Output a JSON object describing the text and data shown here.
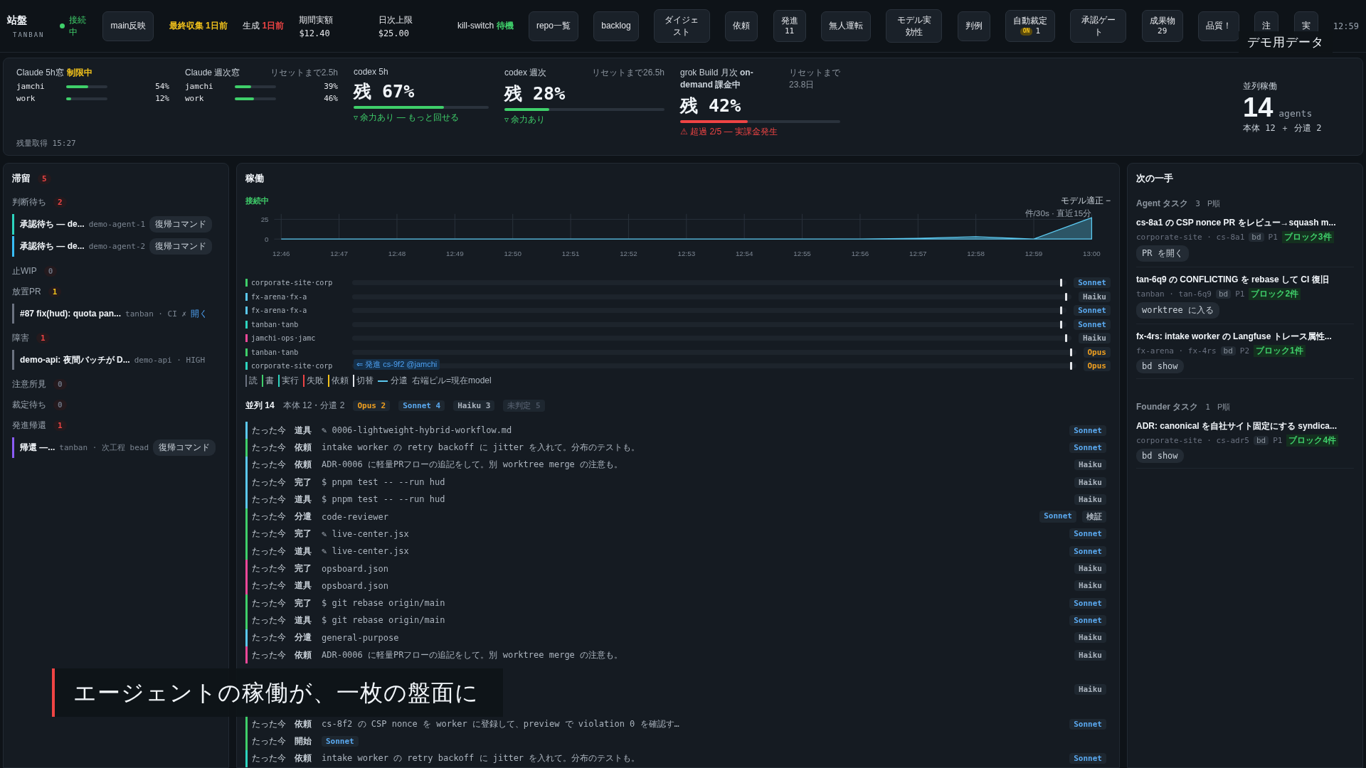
{
  "top_bar": {
    "brand": {
      "title": "站盤",
      "subtitle": "TANBAN"
    },
    "connection": {
      "label": "接続中",
      "on": true
    },
    "items": [
      {
        "kind": "button",
        "label": "main反映"
      },
      {
        "kind": "alert",
        "label": "最終収集 1日前",
        "color": "#f2c21b"
      },
      {
        "kind": "flag",
        "label": "生成",
        "value": "1日前",
        "color": "#ef4444"
      },
      {
        "kind": "stat",
        "label": "期間実額",
        "value": "$12.40"
      },
      {
        "kind": "stat",
        "label": "日次上限",
        "value": "$25.00"
      },
      {
        "kind": "flag",
        "label": "kill-switch",
        "value": "待機",
        "color": "#3fcf6a"
      },
      {
        "kind": "button",
        "label": "repo一覧"
      },
      {
        "kind": "button",
        "label": "backlog"
      },
      {
        "kind": "button",
        "label": "ダイジェスト"
      },
      {
        "kind": "button",
        "label": "依頼"
      },
      {
        "kind": "button",
        "label": "発進",
        "sub": "11"
      },
      {
        "kind": "button",
        "label": "無人運転"
      },
      {
        "kind": "button",
        "label": "モデル実効性"
      },
      {
        "kind": "button",
        "label": "判例"
      },
      {
        "kind": "button",
        "label": "自動裁定",
        "badge": "ON",
        "sub": "1"
      },
      {
        "kind": "button",
        "label": "承認ゲート"
      },
      {
        "kind": "button",
        "label": "成果物",
        "sub": "29"
      },
      {
        "kind": "button",
        "label": "品質！"
      },
      {
        "kind": "button",
        "label": "注"
      },
      {
        "kind": "button",
        "label": "実"
      }
    ],
    "clock": "12:59"
  },
  "demo_badge": "デモ用データ",
  "quota": {
    "groups": [
      {
        "kind": "accounts",
        "header": "Claude 5h窓",
        "flag": "制限中",
        "accounts": [
          {
            "name": "jamchi",
            "level": 0.54,
            "reading": "54%"
          },
          {
            "name": "work",
            "level": 0.12,
            "reading": "12%"
          }
        ]
      },
      {
        "kind": "accounts",
        "header": "Claude 週次窓",
        "reset": "リセットまで2.5h",
        "accounts": [
          {
            "name": "jamchi",
            "level": 0.39,
            "reading": "39%"
          },
          {
            "name": "work",
            "level": 0.46,
            "reading": "46%"
          }
        ]
      },
      {
        "kind": "remaining",
        "header": "codex 5h",
        "value": "残 67%",
        "level": 0.67,
        "color": "#3fcf6a",
        "note": "▿ 余力あり — もっと回せる"
      },
      {
        "kind": "remaining",
        "header": "codex 週次",
        "reset": "リセットまで26.5h",
        "value": "残 28%",
        "level": 0.28,
        "color": "#3fcf6a",
        "note": "▿ 余力あり"
      },
      {
        "kind": "remaining",
        "header": "grok Build 月次 **on-demand 課金中**",
        "reset": "リセットまで23.8日",
        "value": "残 42%",
        "level": 0.42,
        "color": "#ef4444",
        "note": "⚠ 超過 2/5 — 実課金発生"
      }
    ],
    "footer": "残量取得 15:27",
    "parallel": {
      "label": "並列稼働",
      "value": "14",
      "unit": "agents",
      "detail": "本体 12 ＋ 分遣 2"
    }
  },
  "backlog": {
    "title": "滞留",
    "count": "5",
    "color": "#ef4444",
    "groups": [
      {
        "label": "判断待ち",
        "count": "2",
        "color": "#ef4444",
        "items": [
          {
            "title": "承認待ち — de...",
            "meta": "demo-agent-1",
            "color": "#2dd4bf",
            "action": {
              "kind": "button",
              "label": "復帰コマンド"
            }
          },
          {
            "title": "承認待ち — de...",
            "meta": "demo-agent-2",
            "color": "#38bdf8",
            "action": {
              "kind": "button",
              "label": "復帰コマンド"
            }
          }
        ]
      },
      {
        "label": "止WIP",
        "count": "0",
        "color": "#6b7280"
      },
      {
        "label": "放置PR",
        "count": "1",
        "color": "#f2c21b",
        "items": [
          {
            "title": "#87 fix(hud): quota pan...",
            "meta": "tanban · CI ✗",
            "color": "#6b7280",
            "action": {
              "kind": "link",
              "label": "開く"
            }
          }
        ]
      },
      {
        "label": "障害",
        "count": "1",
        "color": "#ef4444",
        "items": [
          {
            "title": "demo-api: 夜間バッチが D...",
            "meta": "demo-api · HIGH",
            "color": "#6b7280"
          }
        ]
      },
      {
        "label": "注意所見",
        "count": "0",
        "color": "#6b7280"
      },
      {
        "label": "裁定待ち",
        "count": "0",
        "color": "#6b7280"
      },
      {
        "label": "発進帰還",
        "count": "1",
        "color": "#ef4444",
        "items": [
          {
            "title": "帰還 —...",
            "meta": "tanban · 次工程 bead",
            "color": "#8b5cf6",
            "action": {
              "kind": "button",
              "label": "復帰コマンド"
            }
          }
        ]
      }
    ]
  },
  "activity": {
    "title": "稼働",
    "status": "接続中",
    "toggle": "モデル適正 −",
    "chart_data": {
      "type": "area",
      "grid": true,
      "ylabel": "件/30s · 直近15分",
      "x": [
        "12:46",
        "12:47",
        "12:48",
        "12:49",
        "12:50",
        "12:51",
        "12:52",
        "12:53",
        "12:54",
        "12:55",
        "12:56",
        "12:57",
        "12:58",
        "12:59",
        "13:00"
      ],
      "yticks": [
        0,
        25
      ],
      "ylim": [
        0,
        30
      ],
      "series": [
        {
          "color": "#5bc8ef",
          "values": [
            0,
            0,
            0,
            0,
            0,
            0,
            0,
            0,
            0,
            0,
            0,
            1,
            3,
            0,
            27
          ]
        }
      ]
    },
    "lanes": [
      {
        "name": "corporate-site·corp",
        "color": "#3fcf6a",
        "model": {
          "label": "Sonnet",
          "color": "#5aa9f0"
        }
      },
      {
        "name": "fx-arena·fx-a",
        "color": "#5bc8ef",
        "model": {
          "label": "Haiku",
          "color": "#aab3bd"
        }
      },
      {
        "name": "fx-arena·fx-a",
        "color": "#5bc8ef",
        "model": {
          "label": "Sonnet",
          "color": "#5aa9f0"
        }
      },
      {
        "name": "tanban·tanb",
        "color": "#2dd4bf",
        "model": {
          "label": "Sonnet",
          "color": "#5aa9f0"
        }
      },
      {
        "name": "jamchi-ops·jamc",
        "color": "#ec4899",
        "model": {
          "label": "Haiku",
          "color": "#aab3bd"
        }
      },
      {
        "name": "tanban·tanb",
        "color": "#3fcf6a",
        "model": {
          "label": "Opus",
          "color": "#f0a020"
        }
      },
      {
        "name": "corporate-site·corp",
        "color": "#2dd4bf",
        "link": "⇐ 発進 cs-9f2 @jamchi",
        "model": {
          "label": "Opus",
          "color": "#f0a020"
        }
      }
    ],
    "legend": [
      {
        "label": "読",
        "color": "#6b7280"
      },
      {
        "label": "書",
        "color": "#3fcf6a"
      },
      {
        "label": "実行",
        "color": "#2dd4bf"
      },
      {
        "label": "失敗",
        "color": "#ef4444"
      },
      {
        "label": "依頼",
        "color": "#f2c21b"
      },
      {
        "label": "切替",
        "color": "#e5e7eb"
      }
    ],
    "legend_branch": "分遣",
    "legend_note": "右端ピル=現在model",
    "summary": {
      "label": "並列 14",
      "detail": "本体 12・分遣 2",
      "pills": [
        {
          "label": "Opus 2",
          "color": "#f0a020"
        },
        {
          "label": "Sonnet 4",
          "color": "#5aa9f0"
        },
        {
          "label": "Haiku 3",
          "color": "#aab3bd"
        },
        {
          "label": "未判定 5",
          "color": "#4b5563"
        }
      ]
    },
    "rows": [
      {
        "kind": "event",
        "time": "たった今",
        "type": "道具",
        "text": "✎ 0006-lightweight-hybrid-workflow.md",
        "color": "#5bc8ef",
        "models": [
          {
            "label": "Sonnet",
            "color": "#5aa9f0"
          }
        ]
      },
      {
        "kind": "event",
        "time": "たった今",
        "type": "依頼",
        "text": "intake worker の retry backoff に jitter を入れて。分布のテストも。",
        "color": "#3fcf6a",
        "models": [
          {
            "label": "Sonnet",
            "color": "#5aa9f0"
          }
        ]
      },
      {
        "kind": "event",
        "time": "たった今",
        "type": "依頼",
        "text": "ADR-0006 に軽量PRフローの追記をして。別 worktree merge の注意も。",
        "color": "#5bc8ef",
        "models": [
          {
            "label": "Haiku",
            "color": "#aab3bd"
          }
        ]
      },
      {
        "kind": "event",
        "time": "たった今",
        "type": "完了",
        "text": "$ pnpm test -- --run hud",
        "color": "#5bc8ef",
        "models": [
          {
            "label": "Haiku",
            "color": "#aab3bd"
          }
        ]
      },
      {
        "kind": "event",
        "time": "たった今",
        "type": "道具",
        "text": "$ pnpm test -- --run hud",
        "color": "#5bc8ef",
        "models": [
          {
            "label": "Haiku",
            "color": "#aab3bd"
          }
        ]
      },
      {
        "kind": "event",
        "time": "たった今",
        "type": "分遣",
        "text": "code-reviewer",
        "color": "#3fcf6a",
        "models": [
          {
            "label": "Sonnet",
            "color": "#5aa9f0"
          },
          {
            "label": "検証",
            "color": "#aab3bd"
          }
        ]
      },
      {
        "kind": "event",
        "time": "たった今",
        "type": "完了",
        "text": "✎ live-center.jsx",
        "color": "#3fcf6a",
        "models": [
          {
            "label": "Sonnet",
            "color": "#5aa9f0"
          }
        ]
      },
      {
        "kind": "event",
        "time": "たった今",
        "type": "道具",
        "text": "✎ live-center.jsx",
        "color": "#3fcf6a",
        "models": [
          {
            "label": "Sonnet",
            "color": "#5aa9f0"
          }
        ]
      },
      {
        "kind": "event",
        "time": "たった今",
        "type": "完了",
        "text": "opsboard.json",
        "color": "#ec4899",
        "models": [
          {
            "label": "Haiku",
            "color": "#aab3bd"
          }
        ]
      },
      {
        "kind": "event",
        "time": "たった今",
        "type": "道具",
        "text": "opsboard.json",
        "color": "#ec4899",
        "models": [
          {
            "label": "Haiku",
            "color": "#aab3bd"
          }
        ]
      },
      {
        "kind": "event",
        "time": "たった今",
        "type": "完了",
        "text": "$ git rebase origin/main",
        "color": "#3fcf6a",
        "models": [
          {
            "label": "Sonnet",
            "color": "#5aa9f0"
          }
        ]
      },
      {
        "kind": "event",
        "time": "たった今",
        "type": "道具",
        "text": "$ git rebase origin/main",
        "color": "#3fcf6a",
        "models": [
          {
            "label": "Sonnet",
            "color": "#5aa9f0"
          }
        ]
      },
      {
        "kind": "event",
        "time": "たった今",
        "type": "分遣",
        "text": "general-purpose",
        "color": "#5bc8ef",
        "models": [
          {
            "label": "Haiku",
            "color": "#aab3bd"
          }
        ]
      },
      {
        "kind": "event",
        "time": "たった今",
        "type": "依頼",
        "text": "ADR-0006 に軽量PRフローの追記をして。別 worktree merge の注意も。",
        "color": "#ec4899",
        "models": [
          {
            "label": "Haiku",
            "color": "#aab3bd"
          }
        ]
      },
      {
        "kind": "covered"
      },
      {
        "kind": "covered",
        "models": [
          {
            "label": "Haiku",
            "color": "#aab3bd"
          }
        ]
      },
      {
        "kind": "covered"
      },
      {
        "kind": "event",
        "time": "たった今",
        "type": "依頼",
        "text": "cs-8f2 の CSP nonce を worker に登録して、preview で violation 0 を確認す…",
        "color": "#3fcf6a",
        "models": [
          {
            "label": "Sonnet",
            "color": "#5aa9f0"
          }
        ]
      },
      {
        "kind": "start",
        "time": "たった今",
        "type": "開始",
        "color": "#3fcf6a",
        "models": [
          {
            "label": "Sonnet",
            "color": "#5aa9f0"
          }
        ]
      },
      {
        "kind": "event",
        "time": "たった今",
        "type": "依頼",
        "text": "intake worker の retry backoff に jitter を入れて。分布のテストも。",
        "color": "#2dd4bf",
        "models": [
          {
            "label": "Sonnet",
            "color": "#5aa9f0"
          }
        ]
      }
    ]
  },
  "next": {
    "title": "次の一手",
    "sections": [
      {
        "label": "Agent タスク",
        "count": "3",
        "order": "P順",
        "items": [
          {
            "title": "cs-8a1 の CSP nonce PR をレビュー→squash m...",
            "meta": "corporate-site · cs-8a1",
            "tag": "bd",
            "priority": "P1",
            "blocks": "ブロック3件",
            "action": "PR を開く"
          },
          {
            "title": "tan-6q9 の CONFLICTING を rebase して CI 復旧",
            "meta": "tanban · tan-6q9",
            "tag": "bd",
            "priority": "P1",
            "blocks": "ブロック2件",
            "action": "worktree に入る"
          },
          {
            "title": "fx-4rs: intake worker の Langfuse トレース属性...",
            "meta": "fx-arena · fx-4rs",
            "tag": "bd",
            "priority": "P2",
            "blocks": "ブロック1件",
            "action": "bd show"
          }
        ]
      },
      {
        "label": "Founder タスク",
        "count": "1",
        "order": "P順",
        "items": [
          {
            "title": "ADR: canonical を自社サイト固定にする syndica...",
            "meta": "corporate-site · cs-adr5",
            "tag": "bd",
            "priority": "P1",
            "blocks": "ブロック4件",
            "action": "bd show"
          }
        ]
      }
    ]
  },
  "caption": "エージェントの稼働が、一枚の盤面に"
}
